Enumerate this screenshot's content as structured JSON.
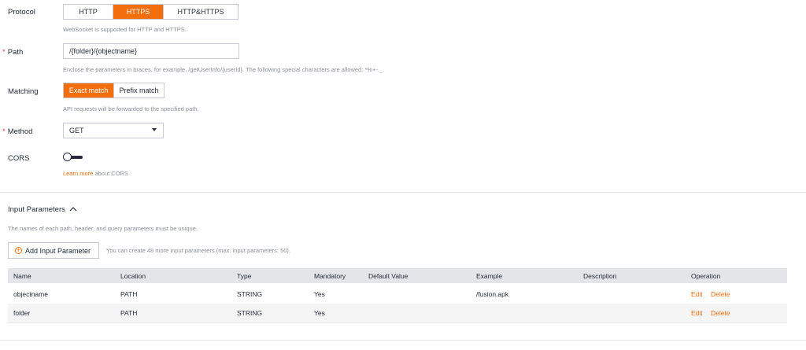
{
  "protocol": {
    "label": "Protocol",
    "options": [
      "HTTP",
      "HTTPS",
      "HTTP&HTTPS"
    ],
    "selected": "HTTPS",
    "hint": "WebSocket is supported for HTTP and HTTPS."
  },
  "path": {
    "label": "Path",
    "value": "/{folder}/{objectname}",
    "hint": "Enclose the parameters in braces, for example, /getUserInfo/{userId}. The following special characters are allowed: *%+-._."
  },
  "matching": {
    "label": "Matching",
    "options": [
      "Exact match",
      "Prefix match"
    ],
    "selected": "Exact match",
    "hint": "API requests will be forwarded to the specified path."
  },
  "method": {
    "label": "Method",
    "value": "GET"
  },
  "cors": {
    "label": "CORS",
    "enabled": false,
    "learn_more": "Learn more",
    "learn_more_suffix": " about CORS"
  },
  "input_params": {
    "title": "Input Parameters",
    "hint": "The names of each path, header, and query parameters must be unique.",
    "add_button": "Add Input Parameter",
    "add_hint": "You can create 48 more input parameters (max. input parameters: 50).",
    "columns": [
      "Name",
      "Location",
      "Type",
      "Mandatory",
      "Default Value",
      "Example",
      "Description",
      "Operation"
    ],
    "rows": [
      {
        "name": "objectname",
        "location": "PATH",
        "type": "STRING",
        "mandatory": "Yes",
        "default": "",
        "example": "/fusion.apk",
        "description": "",
        "edit": "Edit",
        "delete": "Delete"
      },
      {
        "name": "folder",
        "location": "PATH",
        "type": "STRING",
        "mandatory": "Yes",
        "default": "",
        "example": "",
        "description": "",
        "edit": "Edit",
        "delete": "Delete"
      }
    ]
  },
  "colors": {
    "accent": "#f36e0c",
    "required": "#e54545",
    "header_bg": "#e3e5e8"
  }
}
